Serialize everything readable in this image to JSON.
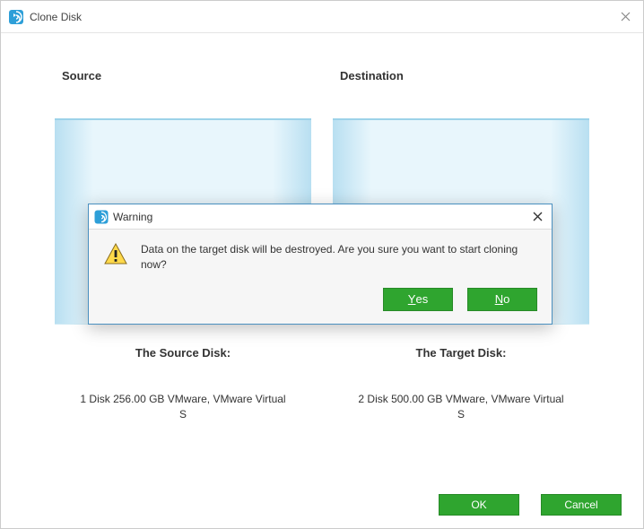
{
  "window": {
    "title": "Clone Disk"
  },
  "source": {
    "header": "Source",
    "label": "The Source Disk:",
    "desc": "1 Disk 256.00 GB VMware,  VMware Virtual S"
  },
  "destination": {
    "header": "Destination",
    "label": "The Target Disk:",
    "desc": "2 Disk 500.00 GB VMware,  VMware Virtual S"
  },
  "footer": {
    "ok": "OK",
    "cancel": "Cancel"
  },
  "dialog": {
    "title": "Warning",
    "message": "Data on the target disk will be destroyed. Are you sure you want to start cloning now?",
    "yes_u": "Y",
    "yes_rest": "es",
    "no_u": "N",
    "no_rest": "o"
  }
}
